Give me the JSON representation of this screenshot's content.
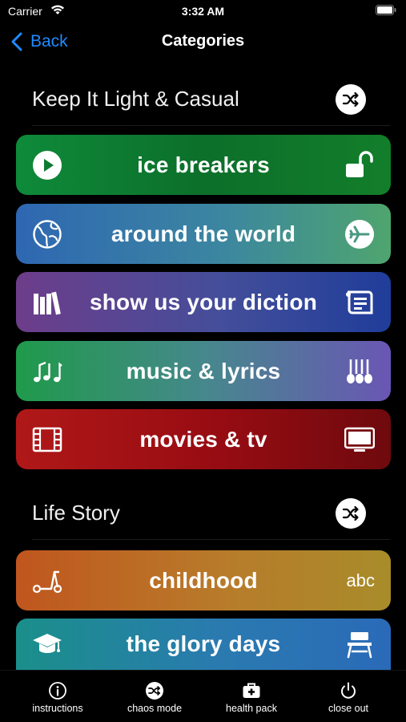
{
  "status": {
    "carrier": "Carrier",
    "time": "3:32 AM"
  },
  "nav": {
    "back_label": "Back",
    "title": "Categories"
  },
  "sections": [
    {
      "title": "Keep It Light & Casual"
    },
    {
      "title": "Life Story"
    }
  ],
  "categories": [
    {
      "label": "ice breakers",
      "left_icon": "play-circle-icon",
      "right_icon": "unlocked-padlock-icon"
    },
    {
      "label": "around the world",
      "left_icon": "globe-icon",
      "right_icon": "airplane-circle-icon"
    },
    {
      "label": "show us your diction",
      "left_icon": "books-icon",
      "right_icon": "scroll-icon"
    },
    {
      "label": "music & lyrics",
      "left_icon": "music-notes-icon",
      "right_icon": "guitars-icon"
    },
    {
      "label": "movies & tv",
      "left_icon": "film-icon",
      "right_icon": "tv-icon"
    },
    {
      "label": "childhood",
      "left_icon": "scooter-icon",
      "right_text": "abc"
    },
    {
      "label": "the glory days",
      "left_icon": "graduation-cap-icon",
      "right_icon": "school-desk-icon"
    }
  ],
  "tabs": [
    {
      "label": "instructions",
      "icon": "info-icon"
    },
    {
      "label": "chaos mode",
      "icon": "shuffle-icon"
    },
    {
      "label": "health pack",
      "icon": "first-aid-kit-icon"
    },
    {
      "label": "close out",
      "icon": "power-icon"
    }
  ],
  "colors": {
    "accent": "#1f8bff",
    "background": "#000000"
  }
}
